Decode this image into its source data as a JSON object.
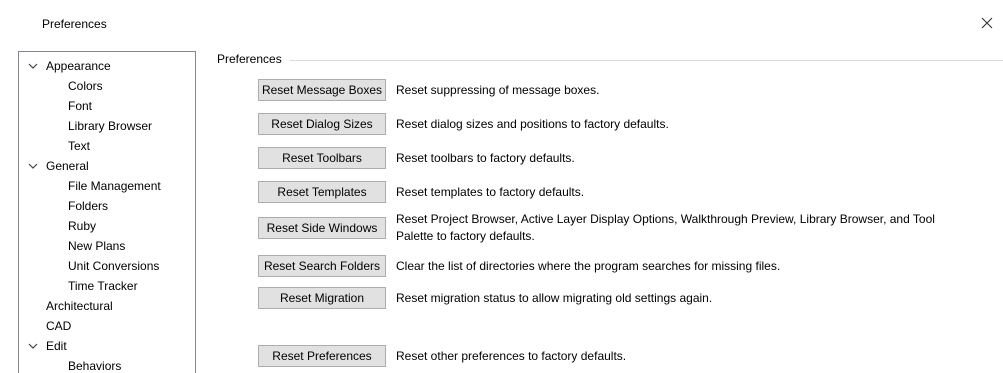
{
  "window": {
    "title": "Preferences",
    "close_icon": "close-icon"
  },
  "tree": {
    "items": [
      {
        "label": "Appearance",
        "level": 0,
        "expanded": true
      },
      {
        "label": "Colors",
        "level": 1
      },
      {
        "label": "Font",
        "level": 1
      },
      {
        "label": "Library Browser",
        "level": 1
      },
      {
        "label": "Text",
        "level": 1
      },
      {
        "label": "General",
        "level": 0,
        "expanded": true
      },
      {
        "label": "File Management",
        "level": 1
      },
      {
        "label": "Folders",
        "level": 1
      },
      {
        "label": "Ruby",
        "level": 1
      },
      {
        "label": "New Plans",
        "level": 1
      },
      {
        "label": "Unit Conversions",
        "level": 1
      },
      {
        "label": "Time Tracker",
        "level": 1
      },
      {
        "label": "Architectural",
        "level": 0
      },
      {
        "label": "CAD",
        "level": 0
      },
      {
        "label": "Edit",
        "level": 0,
        "expanded": true
      },
      {
        "label": "Behaviors",
        "level": 1
      }
    ]
  },
  "panel": {
    "group_label": "Preferences",
    "actions": [
      {
        "button": "Reset Message Boxes",
        "description": "Reset suppressing of message boxes."
      },
      {
        "button": "Reset Dialog Sizes",
        "description": "Reset dialog sizes and positions to factory defaults."
      },
      {
        "button": "Reset Toolbars",
        "description": "Reset toolbars to factory defaults."
      },
      {
        "button": "Reset Templates",
        "description": "Reset templates to factory defaults."
      },
      {
        "button": "Reset Side Windows",
        "description_line1": "Reset Project Browser, Active Layer Display Options, Walkthrough Preview, Library Browser, and Tool",
        "description_line2": "Palette to factory defaults."
      },
      {
        "button": "Reset Search Folders",
        "description": "Clear the list of directories where the program searches for missing files."
      },
      {
        "button": "Reset Migration",
        "description": "Reset migration status to allow migrating old settings again."
      },
      {
        "button": "Reset Preferences",
        "description": "Reset other preferences to factory defaults."
      }
    ]
  }
}
